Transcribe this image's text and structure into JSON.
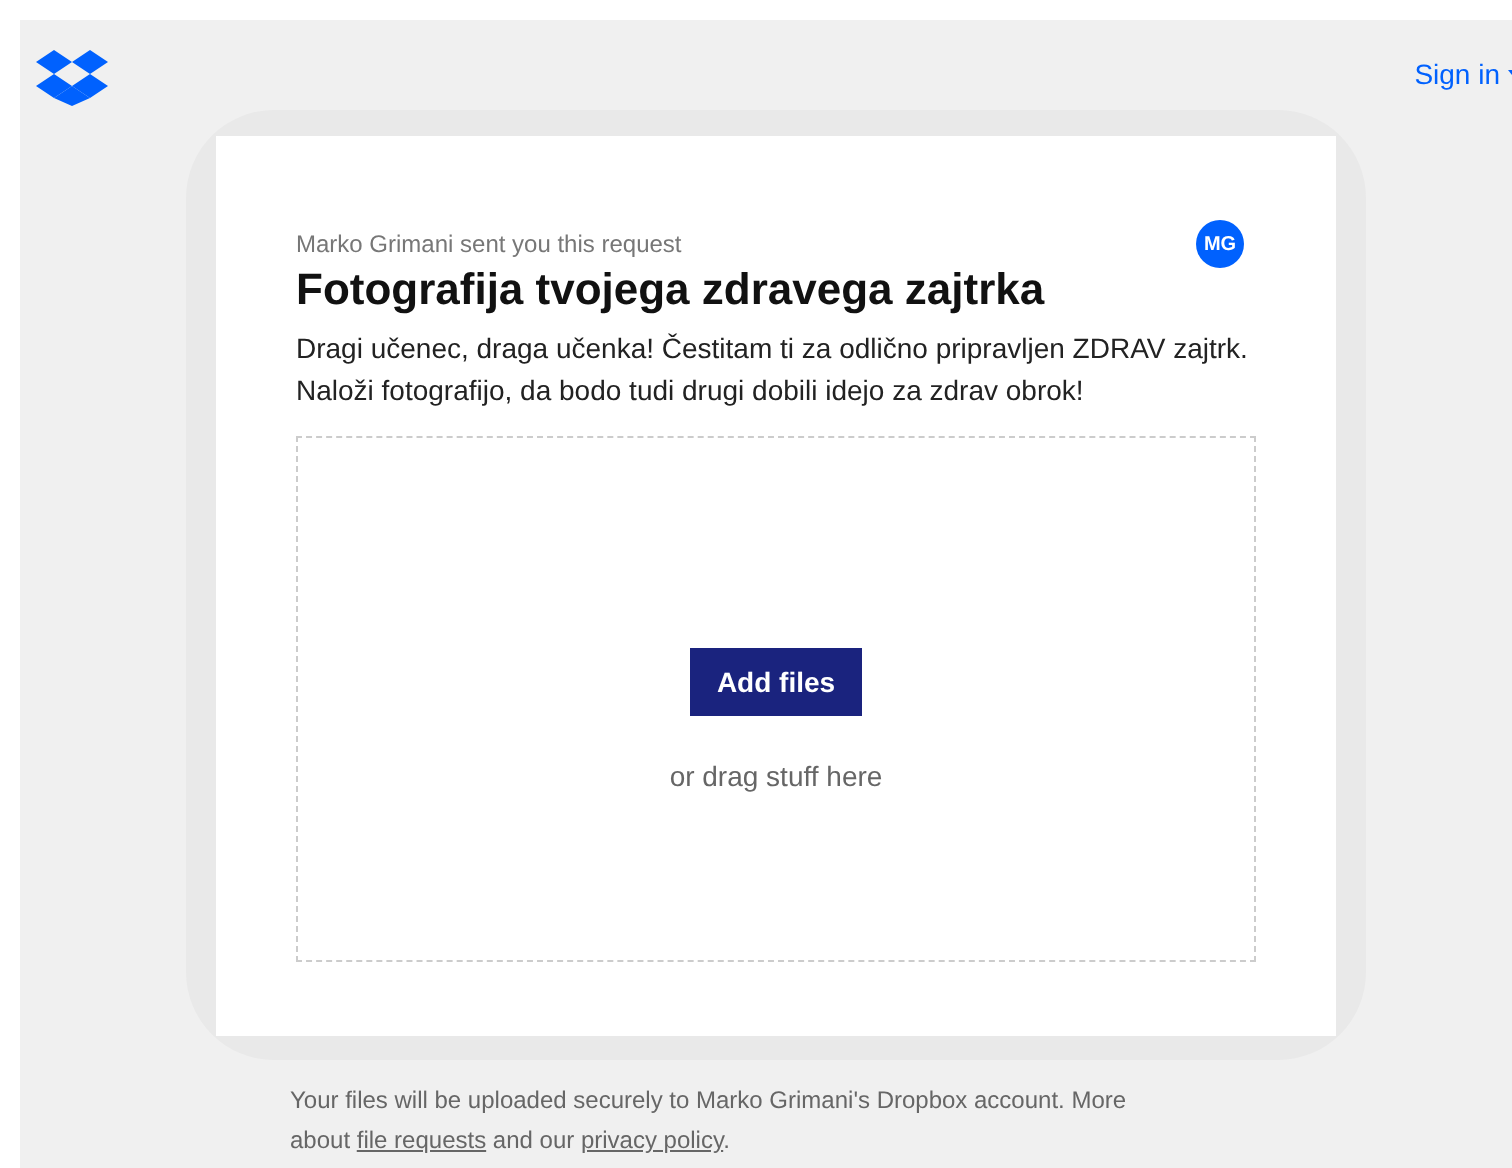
{
  "header": {
    "sign_in": "Sign in"
  },
  "request": {
    "sender_note": "Marko Grimani sent you this request",
    "avatar": "MG",
    "title": "Fotografija tvojega zdravega zajtrka",
    "description": "Dragi učenec, draga učenka! Čestitam ti za odlično pripravljen ZDRAV zajtrk. Naloži fotografijo, da bodo tudi drugi dobili idejo za zdrav obrok!"
  },
  "dropzone": {
    "button": "Add files",
    "hint": "or drag stuff here"
  },
  "footer": {
    "text_before": "Your files will be uploaded securely to Marko Grimani's Dropbox account. More about ",
    "link_1": "file requests",
    "text_middle": " and our ",
    "link_2": "privacy policy",
    "text_after": "."
  }
}
